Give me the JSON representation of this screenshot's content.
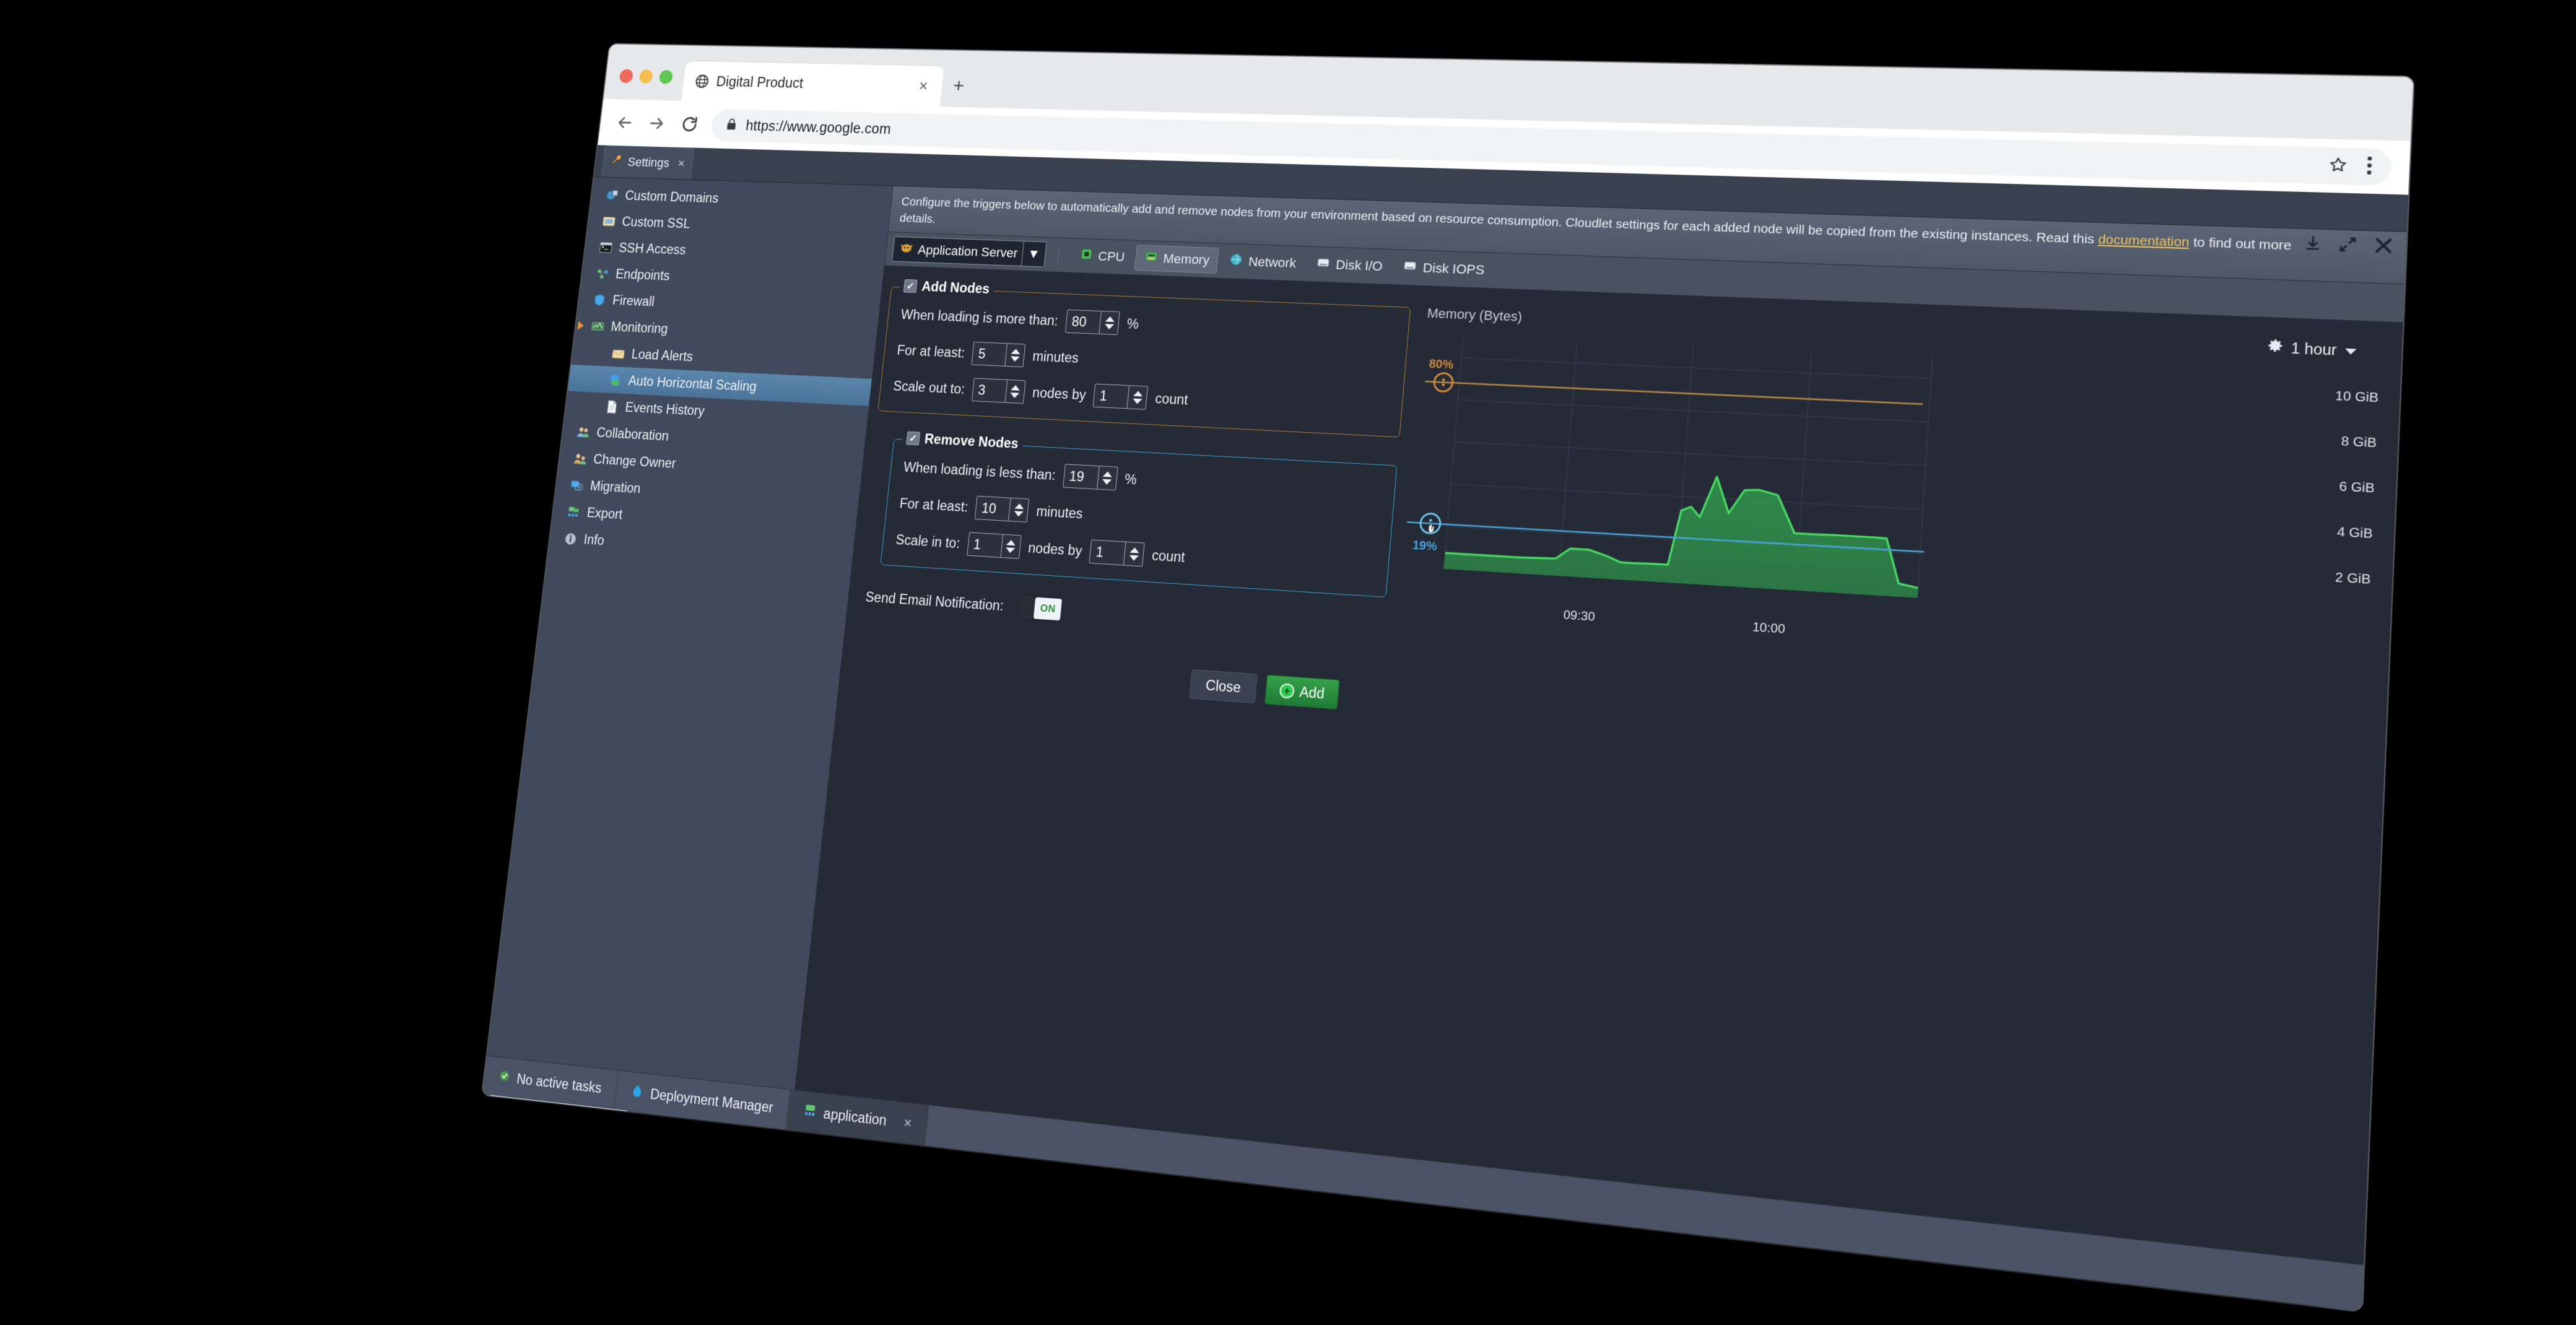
{
  "browser": {
    "tab": {
      "title": "Digital Product",
      "favicon": "globe-icon",
      "close": "×"
    },
    "new_tab": "+",
    "url": "https://www.google.com",
    "back": "←",
    "forward": "→",
    "reload": "↻",
    "lock": "lock-icon",
    "bookmark": "star-icon",
    "menu": "kebab-menu-icon"
  },
  "app": {
    "tab": {
      "label": "Settings",
      "close": "×"
    },
    "sidebar": {
      "items": [
        {
          "label": "Custom Domains",
          "icon": "globe-domain-icon",
          "indent": 0,
          "selected": false
        },
        {
          "label": "Custom SSL",
          "icon": "certificate-icon",
          "indent": 0,
          "selected": false
        },
        {
          "label": "SSH Access",
          "icon": "terminal-icon",
          "indent": 0,
          "selected": false
        },
        {
          "label": "Endpoints",
          "icon": "endpoints-icon",
          "indent": 0,
          "selected": false
        },
        {
          "label": "Firewall",
          "icon": "shield-icon",
          "indent": 0,
          "selected": false
        },
        {
          "label": "Monitoring",
          "icon": "monitoring-icon",
          "indent": 0,
          "selected": false,
          "expanded": true
        },
        {
          "label": "Load Alerts",
          "icon": "envelope-icon",
          "indent": 1,
          "selected": false
        },
        {
          "label": "Auto Horizontal Scaling",
          "icon": "scaling-icon",
          "indent": 1,
          "selected": true
        },
        {
          "label": "Events History",
          "icon": "document-icon",
          "indent": 1,
          "selected": false
        },
        {
          "label": "Collaboration",
          "icon": "users-icon",
          "indent": 0,
          "selected": false
        },
        {
          "label": "Change Owner",
          "icon": "user-swap-icon",
          "indent": 0,
          "selected": false
        },
        {
          "label": "Migration",
          "icon": "migration-icon",
          "indent": 0,
          "selected": false
        },
        {
          "label": "Export",
          "icon": "export-icon",
          "indent": 0,
          "selected": false
        },
        {
          "label": "Info",
          "icon": "info-icon",
          "indent": 0,
          "selected": false
        }
      ]
    },
    "dialog": {
      "description_before": "Configure the triggers below to automatically add and remove nodes from your environment based on resource consumption. Cloudlet settings for each added node will be copied from the existing instances. Read this ",
      "description_link": "documentation",
      "description_after": " to find out more details.",
      "controls": [
        {
          "name": "minimize",
          "glyph": "⤓"
        },
        {
          "name": "maximize",
          "glyph": "⤡"
        },
        {
          "name": "close",
          "glyph": "✕"
        }
      ],
      "node_select": {
        "value": "Application Server",
        "icon": "tomcat-icon",
        "caret": "▼"
      },
      "metric_tabs": [
        {
          "label": "CPU",
          "icon": "cpu-icon",
          "active": false
        },
        {
          "label": "Memory",
          "icon": "memory-icon",
          "active": true
        },
        {
          "label": "Network",
          "icon": "network-icon",
          "active": false
        },
        {
          "label": "Disk I/O",
          "icon": "disk-icon",
          "active": false
        },
        {
          "label": "Disk IOPS",
          "icon": "disk-icon",
          "active": false
        }
      ],
      "add_nodes": {
        "title": "Add Nodes",
        "checked": true,
        "rows": [
          {
            "label": "When loading is more than:",
            "value": "80",
            "suffix": "%"
          },
          {
            "label": "For at least:",
            "value": "5",
            "suffix": "minutes"
          },
          {
            "label": "Scale out to:",
            "value": "3",
            "suffix": "nodes by",
            "value2": "1",
            "suffix2": "count"
          }
        ]
      },
      "remove_nodes": {
        "title": "Remove Nodes",
        "checked": true,
        "rows": [
          {
            "label": "When loading is less than:",
            "value": "19",
            "suffix": "%"
          },
          {
            "label": "For at least:",
            "value": "10",
            "suffix": "minutes"
          },
          {
            "label": "Scale in to:",
            "value": "1",
            "suffix": "nodes by",
            "value2": "1",
            "suffix2": "count"
          }
        ]
      },
      "email_notification": {
        "label": "Send Email Notification:",
        "state": "ON"
      },
      "buttons": {
        "close": "Close",
        "add": "Add"
      }
    },
    "taskbar": {
      "tasks_status": "No active tasks",
      "items": [
        {
          "label": "Deployment Manager",
          "icon": "deployment-icon",
          "active": false,
          "closable": false
        },
        {
          "label": "application",
          "icon": "application-icon",
          "active": true,
          "closable": true,
          "close": "×"
        }
      ],
      "status_url": "https://app.demo.jelastic.com/#"
    }
  },
  "chart_data": {
    "type": "area",
    "title": "Memory (Bytes)",
    "range_label": "1 hour",
    "xlabel": "",
    "ylabel": "",
    "ytick_labels": [
      "10 GiB",
      "8 GiB",
      "6 GiB",
      "4 GiB",
      "2 GiB"
    ],
    "ytick_values": [
      10,
      8,
      6,
      4,
      2
    ],
    "ylim": [
      0,
      11
    ],
    "xtick_labels": [
      "09:30",
      "10:00"
    ],
    "grid": true,
    "legend": "none",
    "series": [
      {
        "name": "Memory",
        "color": "#4cd964",
        "fill": "#2f8f4a",
        "x": [
          0,
          5,
          10,
          16,
          21,
          24,
          27,
          31,
          35,
          38,
          41,
          44,
          46,
          48,
          50,
          52,
          54,
          57,
          60,
          63,
          66,
          70,
          74,
          78,
          82,
          86,
          90,
          93,
          96,
          100
        ],
        "y": [
          0.75,
          0.75,
          0.75,
          0.75,
          0.78,
          0.8,
          1.3,
          1.3,
          1.05,
          0.8,
          0.8,
          0.82,
          0.82,
          0.82,
          3.35,
          3.55,
          3.1,
          5.0,
          3.35,
          4.45,
          4.5,
          4.3,
          2.6,
          2.6,
          2.62,
          2.62,
          2.62,
          2.6,
          0.6,
          0.45
        ]
      }
    ],
    "thresholds": [
      {
        "name": "add-nodes-threshold",
        "label": "80%",
        "color": "#d08a3e",
        "y_fraction": 0.8
      },
      {
        "name": "remove-nodes-threshold",
        "label": "19%",
        "color": "#4aa3dd",
        "y_fraction": 0.19
      }
    ]
  }
}
